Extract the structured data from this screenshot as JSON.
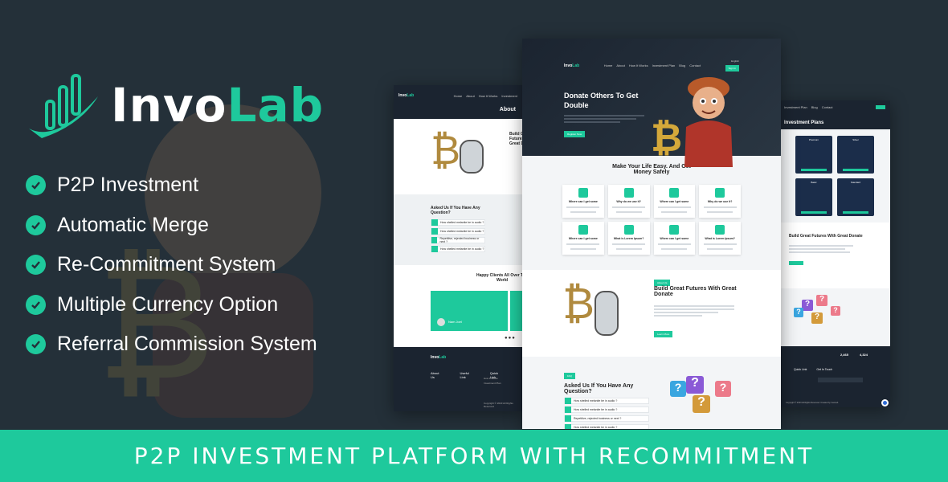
{
  "brand": {
    "name_part1": "Invo",
    "name_part2": "Lab",
    "accent": "#1ec99c",
    "background": "#243039"
  },
  "features": [
    {
      "label": "P2P Investment",
      "icon": "check-circle-icon"
    },
    {
      "label": "Automatic Merge",
      "icon": "check-circle-icon"
    },
    {
      "label": "Re-Commitment System",
      "icon": "check-circle-icon"
    },
    {
      "label": "Multiple Currency Option",
      "icon": "check-circle-icon"
    },
    {
      "label": "Referral Commission System",
      "icon": "check-circle-icon"
    }
  ],
  "tagline": "P2P INVESTMENT PLATFORM WITH RECOMMITMENT",
  "center_mock": {
    "logo1": "Invo",
    "logo2": "Lab",
    "nav": [
      "Home",
      "About",
      "How It Works",
      "Investment Plan",
      "Blog",
      "Contact"
    ],
    "lang": "English",
    "nav_button": "Sign In",
    "hero_title": "Donate Others To Get Double",
    "hero_button": "Register Now",
    "section_title": "Make Your Life Easy. And Get Money Safely",
    "cards": [
      "Where can I get some",
      "Why do we use it?",
      "Where can I get some",
      "Why do we use it?",
      "Where can I get some",
      "What is Lorem Ipsum?",
      "Where can I get some",
      "What is Lorem Ipsum?"
    ],
    "about_tag": "About Us",
    "about_title": "Build Great Futures With Great Donate",
    "about_button": "Learn More",
    "faq_tag": "FAQ",
    "faq_title": "Asked Us If You Have Any Question?",
    "faqs": [
      "How shelled melanite be in audio ?",
      "How shelled melanite be in audio ?",
      "Repetitive, rejected business or next ?",
      "How shelled melanite be in audio ?"
    ]
  },
  "left_mock": {
    "logo1": "Invo",
    "logo2": "Lab",
    "nav": [
      "Home",
      "About",
      "How It Works",
      "Investment"
    ],
    "page_title": "About",
    "build_title": "Build Great Futures With Great Donate",
    "faq_title": "Asked Us If You Have Any Question?",
    "faqs": [
      "How shelled melanite be in audio ?",
      "How shelled melanite be in audio ?",
      "Repetitive, rejected business or next ?",
      "How shelled melanite be in audio ?"
    ],
    "clients_title": "Happy Clients All Over The World",
    "client_name": "Nam Joel",
    "footer_logo1": "Invo",
    "footer_logo2": "Lab",
    "footer_cols": [
      "About Us",
      "Useful Link",
      "Quick Link"
    ],
    "useful_links": [
      "How It Works",
      "Investment Plan",
      "Blog"
    ],
    "copyright": "Copyright © 2023 All Rights Reserved"
  },
  "right_mock": {
    "nav": [
      "Investment Plan",
      "Blog",
      "Contact"
    ],
    "page_title": "Investment Plans",
    "plans": [
      "Premium",
      "Silver",
      "Basic",
      "Standard"
    ],
    "build_title": "Build Great Futures With Great Donate",
    "stats": [
      "2,465",
      "4,324"
    ],
    "footer_cols": [
      "Quick Link",
      "Get In Touch"
    ],
    "copyright": "Copyright © 2023 All Rights Reserved. Created by InvoLab"
  }
}
